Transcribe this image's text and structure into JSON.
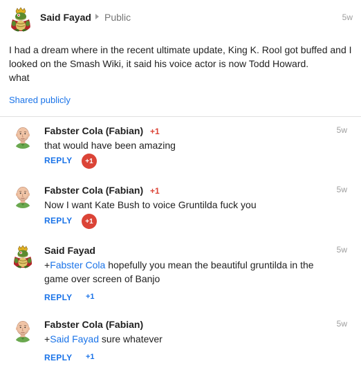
{
  "post": {
    "author": "Said Fayad",
    "visibility": "Public",
    "time": "5w",
    "body_lines": [
      "I had a dream where in the recent ultimate update, King K. Rool got buffed and I",
      "looked on the Smash Wiki, it said his voice actor is now Todd Howard.",
      "what"
    ],
    "shared_label": "Shared publicly"
  },
  "comments": [
    {
      "author": "Fabster Cola (Fabian)",
      "author_plus": "+1",
      "time": "5w",
      "text_before": "that would have  been amazing",
      "mention": "",
      "text_after": "",
      "reply_label": "REPLY",
      "plus_label": "+1",
      "plus_active": true
    },
    {
      "author": "Fabster Cola (Fabian)",
      "author_plus": "+1",
      "time": "5w",
      "text_before": "Now I want Kate Bush to voice Gruntilda fuck you",
      "mention": "",
      "text_after": "",
      "reply_label": "REPLY",
      "plus_label": "+1",
      "plus_active": true
    },
    {
      "author": "Said Fayad",
      "author_plus": "",
      "time": "5w",
      "text_before": "+",
      "mention": "Fabster Cola",
      "text_after": " hopefully you mean the beautiful gruntilda in the game over screen of Banjo",
      "reply_label": "REPLY",
      "plus_label": "+1",
      "plus_active": false
    },
    {
      "author": "Fabster Cola (Fabian)",
      "author_plus": "",
      "time": "5w",
      "text_before": "+",
      "mention": "Said Fayad",
      "text_after": " sure whatever",
      "reply_label": "REPLY",
      "plus_label": "+1",
      "plus_active": false
    }
  ],
  "colors": {
    "link": "#1a73e8",
    "plus_red": "#db4437",
    "muted": "#9e9e9e"
  },
  "icons": {
    "post_avatar": "king-k-rool-avatar",
    "fabian_avatar": "bald-man-avatar"
  }
}
